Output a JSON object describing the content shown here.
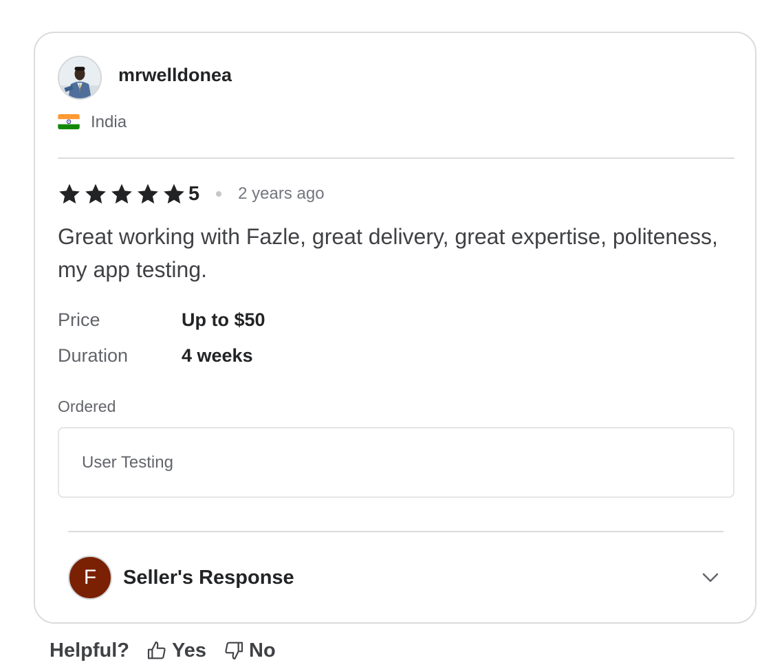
{
  "review": {
    "username": "mrwelldonea",
    "country": "India",
    "rating": "5",
    "stars_filled": 5,
    "stars_total": 5,
    "time_ago": "2 years ago",
    "text": "Great working with Fazle, great delivery, great expertise, politeness, my app testing.",
    "details": {
      "price_label": "Price",
      "price_value": "Up to $50",
      "duration_label": "Duration",
      "duration_value": "4 weeks"
    },
    "ordered_label": "Ordered",
    "ordered_item": "User Testing"
  },
  "seller_response": {
    "avatar_letter": "F",
    "avatar_color": "#7a2103",
    "title": "Seller's Response",
    "expand_icon": "chevron-down-icon"
  },
  "helpful": {
    "label": "Helpful?",
    "yes_label": "Yes",
    "no_label": "No",
    "yes_icon": "thumbs-up-icon",
    "no_icon": "thumbs-down-icon"
  },
  "colors": {
    "star": "#222325",
    "border": "#dadbdd",
    "text_primary": "#222325",
    "text_secondary": "#62646a"
  }
}
